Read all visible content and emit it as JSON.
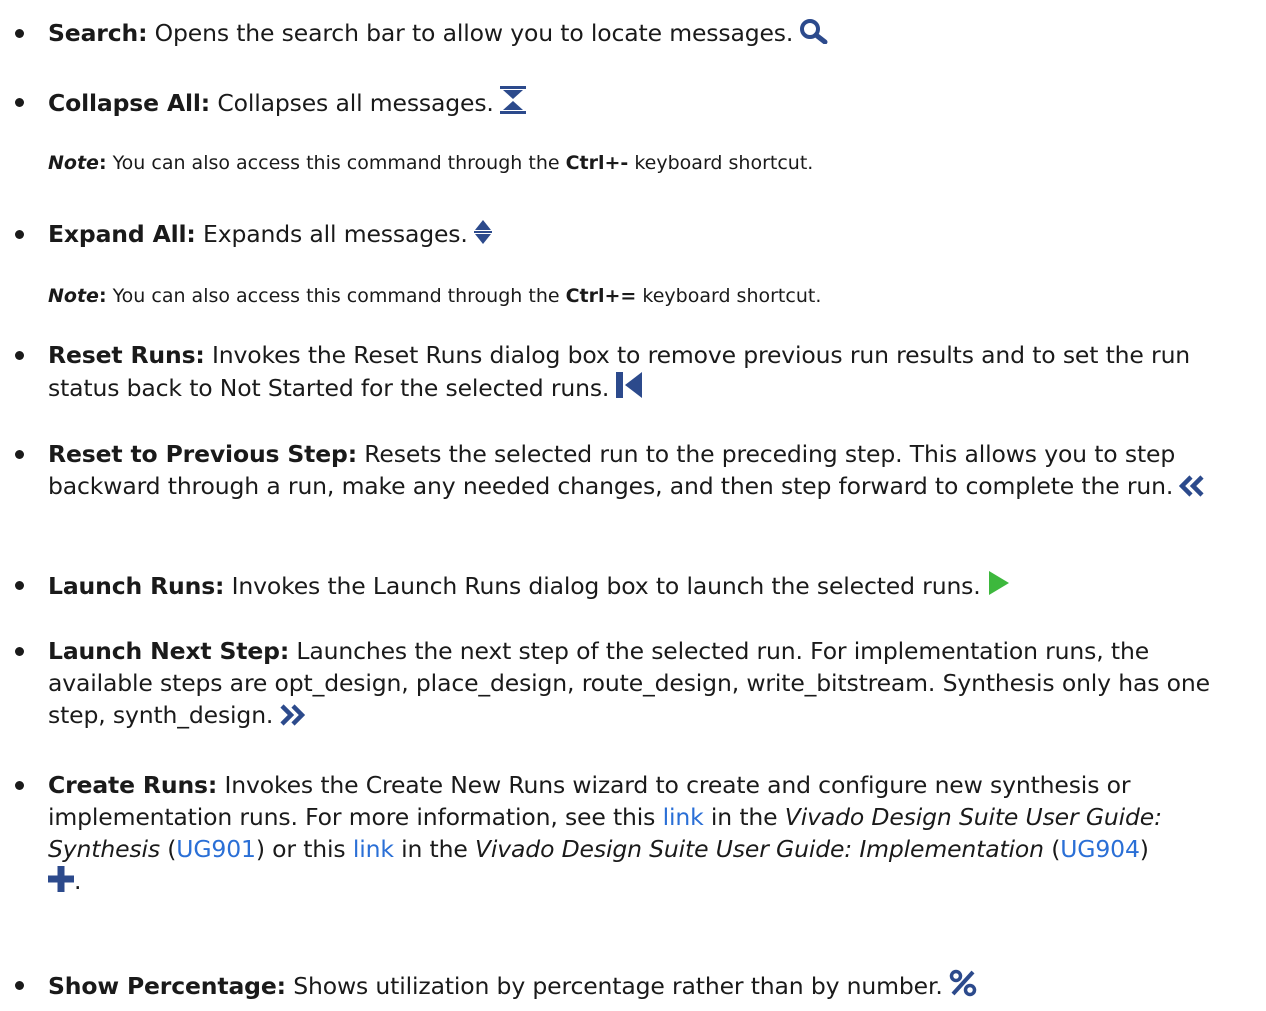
{
  "items": {
    "search": {
      "term": "Search:",
      "desc": " Opens the search bar to allow you to locate messages.",
      "icon": "search-icon"
    },
    "collapse_all": {
      "term": "Collapse All:",
      "desc": " Collapses all messages.",
      "icon": "collapse-all-icon",
      "note": {
        "label": "Note",
        "colon": ":",
        "text_before": " You can also access this command through the ",
        "shortcut": "Ctrl+-",
        "text_after": " keyboard shortcut."
      }
    },
    "expand_all": {
      "term": "Expand All:",
      "desc": " Expands all messages.",
      "icon": "expand-all-icon",
      "note": {
        "label": "Note",
        "colon": ":",
        "text_before": " You can also access this command through the ",
        "shortcut": "Ctrl+=",
        "text_after": " keyboard shortcut."
      }
    },
    "reset_runs": {
      "term": "Reset Runs:",
      "desc": " Invokes the Reset Runs dialog box to remove previous run results and to set the run status back to Not Started for the selected runs.",
      "icon": "reset-runs-icon"
    },
    "reset_previous": {
      "term": "Reset to Previous Step:",
      "desc": " Resets the selected run to the preceding step. This allows you to step backward through a run, make any needed changes, and then step forward to complete the run.",
      "icon": "reset-previous-step-icon"
    },
    "launch_runs": {
      "term": "Launch Runs:",
      "desc": " Invokes the Launch Runs dialog box to launch the selected runs.",
      "icon": "launch-runs-icon",
      "icon_color": "#3db83d"
    },
    "launch_next": {
      "term": "Launch Next Step:",
      "desc": " Launches the next step of the selected run. For implementation runs, the available steps are opt_design, place_design, route_design, write_bitstream. Synthesis only has one step, synth_design.",
      "icon": "launch-next-step-icon"
    },
    "create_runs": {
      "term": "Create Runs:",
      "desc_1": " Invokes the Create New Runs wizard to create and configure new synthesis or implementation runs. For more information, see this ",
      "link_1": "link",
      "desc_2": " in the ",
      "guide_1": "Vivado Design Suite User Guide: Synthesis",
      "paren_open_1": " (",
      "ug_1": "UG901",
      "desc_3": ") or this ",
      "link_2": "link",
      "desc_4": " in the ",
      "guide_2": "Vivado Design Suite User Guide: Implementation",
      "paren_open_2": " (",
      "ug_2": "UG904",
      "paren_close_2": ")",
      "trailing_period": ".",
      "icon": "create-runs-icon"
    },
    "show_percentage": {
      "term": "Show Percentage:",
      "desc": " Shows utilization by percentage rather than by number.",
      "icon": "percentage-icon"
    }
  },
  "colors": {
    "icon_blue": "#2c4a8c",
    "link_blue": "#2a6fd6",
    "play_green": "#3db83d",
    "text": "#1a1a1a"
  }
}
